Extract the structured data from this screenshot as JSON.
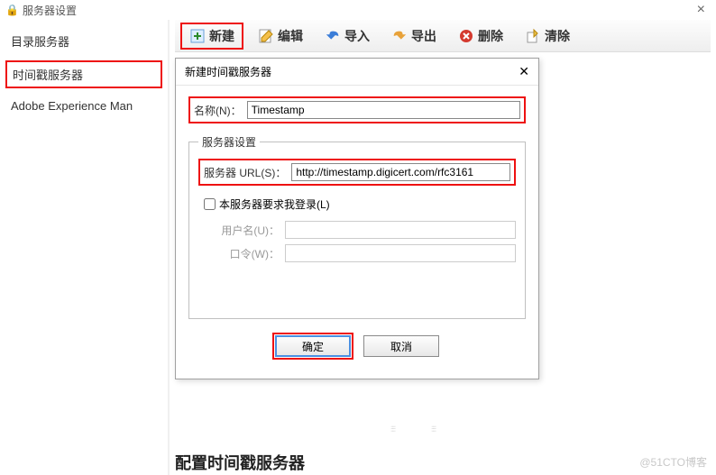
{
  "window": {
    "title": "服务器设置"
  },
  "sidebar": {
    "items": [
      {
        "label": "目录服务器"
      },
      {
        "label": "时间戳服务器"
      },
      {
        "label": "Adobe Experience Man"
      }
    ]
  },
  "toolbar": {
    "new_label": "新建",
    "edit_label": "编辑",
    "import_label": "导入",
    "export_label": "导出",
    "delete_label": "删除",
    "clear_label": "清除"
  },
  "dialog": {
    "title": "新建时间戳服务器",
    "name_label": "名称(N)：",
    "name_value": "Timestamp",
    "group_legend": "服务器设置",
    "url_label": "服务器 URL(S)：",
    "url_value": "http://timestamp.digicert.com/rfc3161",
    "login_checkbox_label": "本服务器要求我登录(L)",
    "username_label": "用户名(U)：",
    "password_label": "口令(W)：",
    "ok_label": "确定",
    "cancel_label": "取消"
  },
  "footer": {
    "heading": "配置时间戳服务器"
  },
  "watermark": "@51CTO博客"
}
